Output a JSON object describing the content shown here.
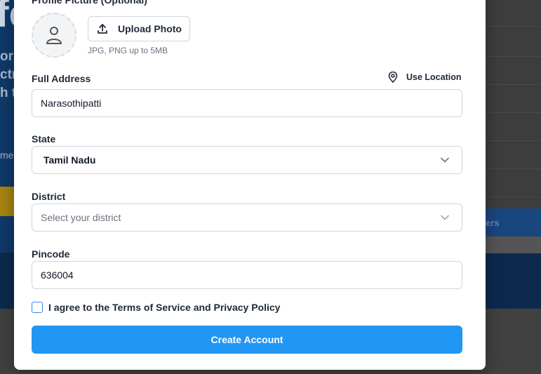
{
  "background": {
    "hero_big": "fe",
    "hero_lines": [
      "ork",
      "ctr",
      "h t"
    ],
    "hero_small": "me",
    "right_link": "ers"
  },
  "form": {
    "profile_label": "Profile Picture (Optional)",
    "upload_label": "Upload Photo",
    "upload_hint": "JPG, PNG up to 5MB",
    "address_label": "Full Address",
    "use_location_label": "Use Location",
    "address_value": "Narasothipatti",
    "state_label": "State",
    "state_value": "Tamil Nadu",
    "district_label": "District",
    "district_placeholder": "Select your district",
    "pincode_label": "Pincode",
    "pincode_value": "636004",
    "terms_label": "I agree to the Terms of Service and Privacy Policy",
    "submit_label": "Create Account"
  },
  "icons": {
    "avatar": "user-icon",
    "upload": "upload-icon",
    "location": "map-pin-icon",
    "chevron": "chevron-down-icon"
  },
  "colors": {
    "primary": "#2196f3",
    "checkbox_border": "#3b82f6"
  }
}
